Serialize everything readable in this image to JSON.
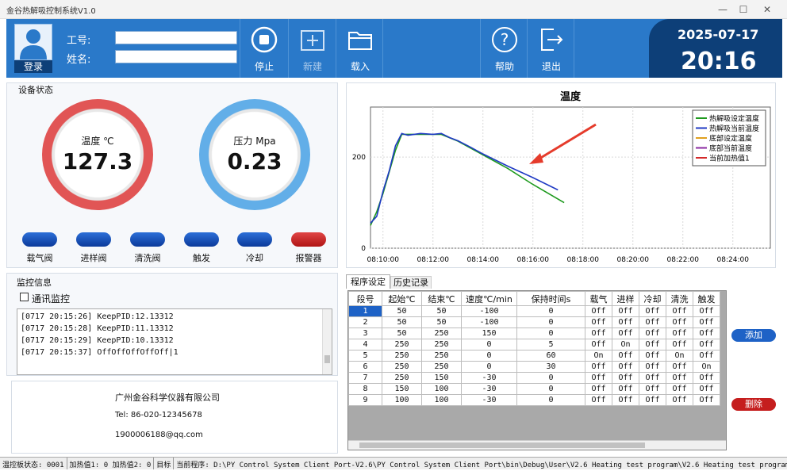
{
  "window": {
    "title": "金谷热解吸控制系统V1.0",
    "min": "—",
    "max": "☐",
    "close": "✕"
  },
  "header": {
    "login_label": "登录",
    "id_label": "工号:",
    "name_label": "姓名:",
    "id_value": "",
    "name_value": "",
    "stop_label": "停止",
    "new_label": "新建",
    "load_label": "载入",
    "help_label": "帮助",
    "exit_label": "退出",
    "date": "2025-07-17",
    "time": "20:16"
  },
  "device": {
    "group_label": "设备状态",
    "temp_label": "温度 ℃",
    "temp_value": "127.3",
    "pressure_label": "压力 Mpa",
    "pressure_value": "0.23",
    "valves": [
      "载气阀",
      "进样阀",
      "清洗阀",
      "触发",
      "冷却",
      "报警器"
    ]
  },
  "monitor": {
    "group_label": "监控信息",
    "checkbox_label": "通讯监控",
    "checked": false,
    "log": [
      "[0717 20:15:26] KeepPID:12.13312",
      "[0717 20:15:28] KeepPID:11.13312",
      "[0717 20:15:29] KeepPID:10.13312",
      "[0717 20:15:37] OffOffOffOffOff|1"
    ]
  },
  "company": {
    "name": "广州金谷科学仪器有限公司",
    "tel": "Tel: 86-020-12345678",
    "email": "1900006188@qq.com"
  },
  "chart_data": {
    "type": "line",
    "title": "温度",
    "xlabel": "",
    "ylabel": "",
    "x_ticks": [
      "08:10:00",
      "08:12:00",
      "08:14:00",
      "08:16:00",
      "08:18:00",
      "08:20:00",
      "08:22:00",
      "08:24:00"
    ],
    "y_ticks": [
      0,
      200
    ],
    "xlim": [
      "08:09:30",
      "08:25:30"
    ],
    "ylim": [
      0,
      310
    ],
    "legend_position": "top-right",
    "grid": true,
    "series": [
      {
        "name": "热解吸设定温度",
        "color": "#1f9a1f",
        "x": [
          "08:09:30",
          "08:09:45",
          "08:10:00",
          "08:10:30",
          "08:10:45",
          "08:11:00",
          "08:12:00",
          "08:12:20",
          "08:13:00",
          "08:14:00",
          "08:15:00",
          "08:16:00",
          "08:17:15"
        ],
        "y": [
          50,
          80,
          120,
          215,
          250,
          250,
          250,
          250,
          235,
          205,
          175,
          140,
          100
        ]
      },
      {
        "name": "热解吸当前温度",
        "color": "#1f3ac4",
        "x": [
          "08:09:30",
          "08:09:45",
          "08:10:00",
          "08:10:15",
          "08:10:30",
          "08:10:45",
          "08:11:00",
          "08:11:30",
          "08:12:00",
          "08:12:20",
          "08:12:40",
          "08:13:00",
          "08:13:30",
          "08:14:00",
          "08:15:00",
          "08:16:00",
          "08:17:00"
        ],
        "y": [
          55,
          70,
          125,
          170,
          225,
          252,
          248,
          252,
          250,
          252,
          243,
          236,
          222,
          207,
          180,
          155,
          128
        ]
      },
      {
        "name": "底部设定温度",
        "color": "#e0a020",
        "x": [],
        "y": []
      },
      {
        "name": "底部当前温度",
        "color": "#8a2aa0",
        "x": [],
        "y": []
      },
      {
        "name": "当前加热值1",
        "color": "#d42a2a",
        "x": [],
        "y": []
      }
    ]
  },
  "program": {
    "tabs": [
      "程序设定",
      "历史记录"
    ],
    "active_tab": 0,
    "columns": [
      "段号",
      "起始℃",
      "结束℃",
      "速度℃/min",
      "保持时间s",
      "载气",
      "进样",
      "冷却",
      "清洗",
      "触发"
    ],
    "rows": [
      [
        "1",
        "50",
        "50",
        "-100",
        "0",
        "Off",
        "Off",
        "Off",
        "Off",
        "Off"
      ],
      [
        "2",
        "50",
        "50",
        "-100",
        "0",
        "Off",
        "Off",
        "Off",
        "Off",
        "Off"
      ],
      [
        "3",
        "50",
        "250",
        "150",
        "0",
        "Off",
        "Off",
        "Off",
        "Off",
        "Off"
      ],
      [
        "4",
        "250",
        "250",
        "0",
        "5",
        "Off",
        "On",
        "Off",
        "Off",
        "Off"
      ],
      [
        "5",
        "250",
        "250",
        "0",
        "60",
        "On",
        "Off",
        "Off",
        "On",
        "Off"
      ],
      [
        "6",
        "250",
        "250",
        "0",
        "30",
        "Off",
        "Off",
        "Off",
        "Off",
        "On"
      ],
      [
        "7",
        "250",
        "150",
        "-30",
        "0",
        "Off",
        "Off",
        "Off",
        "Off",
        "Off"
      ],
      [
        "8",
        "150",
        "100",
        "-30",
        "0",
        "Off",
        "Off",
        "Off",
        "Off",
        "Off"
      ],
      [
        "9",
        "100",
        "100",
        "-30",
        "0",
        "Off",
        "Off",
        "Off",
        "Off",
        "Off"
      ]
    ],
    "selected_row": 0,
    "add_label": "添加",
    "delete_label": "删除"
  },
  "status_bar": [
    "温控板状态: 0001",
    "加热值1: 0  加热值2: 0",
    "目标",
    "当前程序: D:\\PY Control System Client Port-V2.6\\PY Control System Client Port\\bin\\Debug\\User\\V2.6 Heating test program\\V2.6 Heating test program.dat"
  ],
  "colors": {
    "header_blue": "#2a79c9",
    "date_blue": "#0d3f78",
    "accent_red": "#d42a2a"
  }
}
